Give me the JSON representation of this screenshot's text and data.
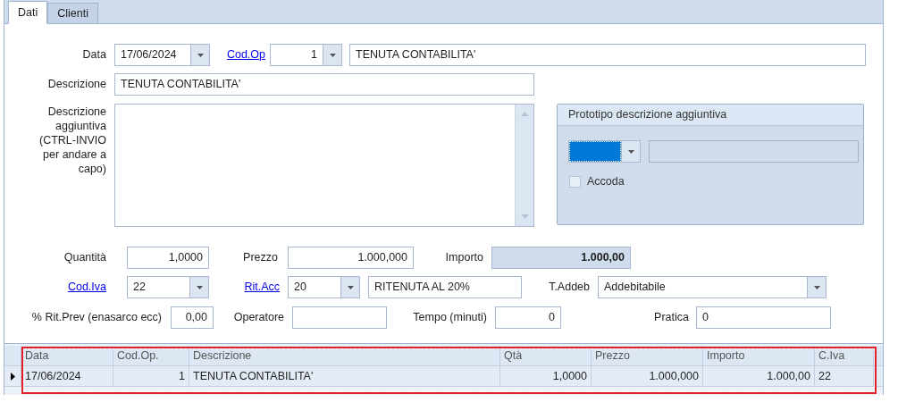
{
  "tabs": [
    {
      "label": "Dati",
      "selected": true
    },
    {
      "label": "Clienti",
      "selected": false
    }
  ],
  "form": {
    "data": {
      "label": "Data",
      "link": false,
      "value": "17/06/2024"
    },
    "cod_op": {
      "label": "Cod.Op",
      "link": true,
      "value": "1",
      "description": "TENUTA CONTABILITA'"
    },
    "descrizione": {
      "label": "Descrizione",
      "link": false,
      "value": "TENUTA CONTABILITA'"
    },
    "descrizione_aggiuntiva": {
      "label": "Descrizione aggiuntiva (CTRL-INVIO per andare a capo)",
      "link": false
    },
    "prototipo": {
      "title": "Prototipo descrizione aggiuntiva",
      "combo_focused": true,
      "checkbox": {
        "label": "Accoda",
        "checked": false
      }
    },
    "quantita": {
      "label": "Quantità",
      "link": false,
      "value": "1,0000"
    },
    "prezzo": {
      "label": "Prezzo",
      "link": false,
      "value": "1.000,000"
    },
    "importo": {
      "label": "Importo",
      "link": false,
      "value": "1.000,00"
    },
    "cod_iva": {
      "label": "Cod.Iva",
      "link": true,
      "value": "22"
    },
    "rit_acc": {
      "label": "Rit.Acc",
      "link": true,
      "value": "20",
      "description": "RITENUTA AL 20%"
    },
    "t_addeb": {
      "label": "T.Addeb",
      "link": false,
      "value": "Addebitabile"
    },
    "rit_prev": {
      "label": "% Rit.Prev (enasarco ecc)",
      "link": false,
      "value": "0,00"
    },
    "operatore": {
      "label": "Operatore",
      "link": false
    },
    "tempo": {
      "label": "Tempo (minuti)",
      "link": false,
      "value": "0"
    },
    "pratica": {
      "label": "Pratica",
      "link": false,
      "value": "0"
    }
  },
  "grid": {
    "columns": [
      {
        "label": "Data",
        "numeric": false
      },
      {
        "label": "Cod.Op.",
        "numeric": true
      },
      {
        "label": "Descrizione",
        "numeric": false
      },
      {
        "label": "Qtà",
        "numeric": true
      },
      {
        "label": "Prezzo",
        "numeric": true
      },
      {
        "label": "Importo",
        "numeric": true
      },
      {
        "label": "C.Iva",
        "numeric": false
      }
    ],
    "rows": [
      {
        "selected": true,
        "cells": [
          "17/06/2024",
          "1",
          "TENUTA CONTABILITA'",
          "1,0000",
          "1.000,000",
          "1.000,00",
          "22"
        ]
      }
    ],
    "design_selected": true
  }
}
